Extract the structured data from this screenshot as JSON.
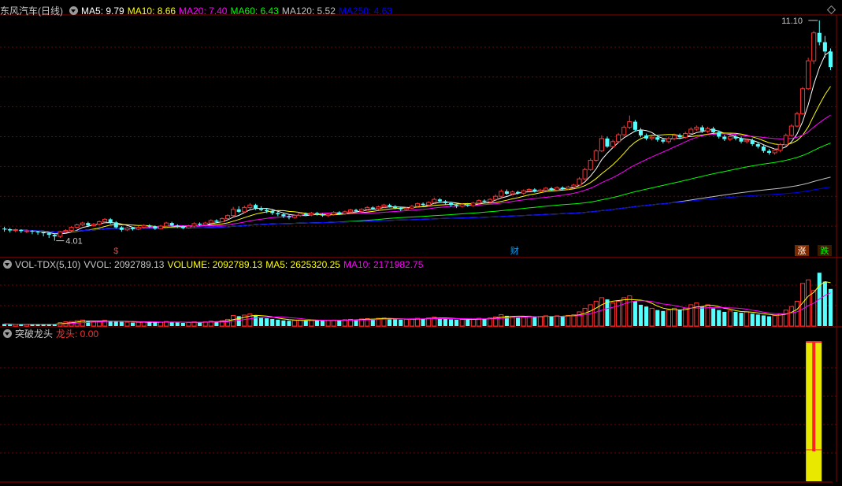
{
  "main_panel": {
    "stock_name": "东风汽车",
    "period": "(日线)",
    "ma_items": [
      {
        "label": "MA5: 9.79",
        "color": "#ffffff"
      },
      {
        "label": "MA10: 8.66",
        "color": "#ffff00"
      },
      {
        "label": "MA20: 7.40",
        "color": "#ff00ff"
      },
      {
        "label": "MA60: 6.43",
        "color": "#00ff00"
      },
      {
        "label": "MA120: 5.52",
        "color": "#c0c0c0"
      },
      {
        "label": "MA250: 4.63",
        "color": "#0000ff"
      }
    ],
    "high_label": "11.10",
    "low_label": "4.01",
    "event_markers": [
      {
        "text": "$",
        "color": "#ff3030"
      },
      {
        "text": "财",
        "color": "#00a0ff"
      },
      {
        "text": "涨",
        "color": "#ffffff"
      },
      {
        "text": "跌",
        "color": "#00ff00"
      }
    ]
  },
  "volume_panel": {
    "title": "VOL-TDX(5,10)",
    "items": [
      {
        "label": "VVOL: 2092789.13",
        "color": "#c8c8c8"
      },
      {
        "label": "VOLUME: 2092789.13",
        "color": "#ffff00"
      },
      {
        "label": "MA5: 2625320.25",
        "color": "#ffff00"
      },
      {
        "label": "MA10: 2171982.75",
        "color": "#ff00ff"
      }
    ]
  },
  "indicator_panel": {
    "title": "突破龙头",
    "items": [
      {
        "label": "龙头: 0.00",
        "color": "#ff3030"
      }
    ]
  },
  "colors": {
    "up": "#ff3333",
    "down": "#54ffff",
    "grid": "#7a0000",
    "signal_outer": "#e8e800",
    "signal_inner": "#ff2020"
  },
  "chart_data": {
    "type": "candlestick",
    "price_range": [
      4.01,
      11.1
    ],
    "ohlc": [
      [
        4.4,
        4.38,
        4.46,
        4.3
      ],
      [
        4.38,
        4.34,
        4.42,
        4.28
      ],
      [
        4.34,
        4.36,
        4.4,
        4.28
      ],
      [
        4.36,
        4.32,
        4.38,
        4.26
      ],
      [
        4.32,
        4.33,
        4.37,
        4.25
      ],
      [
        4.33,
        4.3,
        4.35,
        4.22
      ],
      [
        4.3,
        4.28,
        4.33,
        4.2
      ],
      [
        4.28,
        4.25,
        4.3,
        4.15
      ],
      [
        4.25,
        4.2,
        4.28,
        4.1
      ],
      [
        4.2,
        4.15,
        4.23,
        4.01
      ],
      [
        4.15,
        4.3,
        4.33,
        4.1
      ],
      [
        4.3,
        4.34,
        4.38,
        4.25
      ],
      [
        4.34,
        4.44,
        4.48,
        4.3
      ],
      [
        4.44,
        4.52,
        4.56,
        4.4
      ],
      [
        4.52,
        4.58,
        4.62,
        4.48
      ],
      [
        4.58,
        4.5,
        4.62,
        4.45
      ],
      [
        4.5,
        4.54,
        4.58,
        4.46
      ],
      [
        4.54,
        4.62,
        4.66,
        4.5
      ],
      [
        4.62,
        4.7,
        4.74,
        4.58
      ],
      [
        4.7,
        4.6,
        4.74,
        4.55
      ],
      [
        4.6,
        4.44,
        4.64,
        4.4
      ],
      [
        4.44,
        4.36,
        4.48,
        4.3
      ],
      [
        4.36,
        4.42,
        4.46,
        4.32
      ],
      [
        4.42,
        4.38,
        4.46,
        4.34
      ],
      [
        4.38,
        4.44,
        4.48,
        4.35
      ],
      [
        4.44,
        4.5,
        4.54,
        4.4
      ],
      [
        4.5,
        4.46,
        4.54,
        4.42
      ],
      [
        4.46,
        4.4,
        4.5,
        4.36
      ],
      [
        4.4,
        4.48,
        4.52,
        4.38
      ],
      [
        4.48,
        4.58,
        4.62,
        4.44
      ],
      [
        4.58,
        4.5,
        4.62,
        4.46
      ],
      [
        4.5,
        4.46,
        4.54,
        4.42
      ],
      [
        4.46,
        4.42,
        4.5,
        4.38
      ],
      [
        4.42,
        4.48,
        4.52,
        4.4
      ],
      [
        4.48,
        4.56,
        4.6,
        4.44
      ],
      [
        4.56,
        4.52,
        4.6,
        4.48
      ],
      [
        4.52,
        4.58,
        4.62,
        4.5
      ],
      [
        4.58,
        4.66,
        4.7,
        4.54
      ],
      [
        4.66,
        4.62,
        4.7,
        4.58
      ],
      [
        4.62,
        4.72,
        4.76,
        4.6
      ],
      [
        4.72,
        4.82,
        4.86,
        4.68
      ],
      [
        4.82,
        5.02,
        5.1,
        4.78
      ],
      [
        5.02,
        4.94,
        5.12,
        4.9
      ],
      [
        4.94,
        5.08,
        5.14,
        4.9
      ],
      [
        5.08,
        5.16,
        5.22,
        5.02
      ],
      [
        5.16,
        5.06,
        5.2,
        5.0
      ],
      [
        5.06,
        5.0,
        5.12,
        4.96
      ],
      [
        5.0,
        4.96,
        5.06,
        4.9
      ],
      [
        4.96,
        4.9,
        5.0,
        4.84
      ],
      [
        4.9,
        4.86,
        4.94,
        4.8
      ],
      [
        4.86,
        4.8,
        4.9,
        4.74
      ],
      [
        4.8,
        4.76,
        4.84,
        4.7
      ],
      [
        4.76,
        4.82,
        4.86,
        4.72
      ],
      [
        4.82,
        4.88,
        4.92,
        4.78
      ],
      [
        4.88,
        4.84,
        4.92,
        4.8
      ],
      [
        4.84,
        4.9,
        4.94,
        4.8
      ],
      [
        4.9,
        4.86,
        4.94,
        4.82
      ],
      [
        4.86,
        4.82,
        4.9,
        4.78
      ],
      [
        4.82,
        4.86,
        4.9,
        4.78
      ],
      [
        4.86,
        4.92,
        4.96,
        4.82
      ],
      [
        4.92,
        4.88,
        4.96,
        4.84
      ],
      [
        4.88,
        4.94,
        4.98,
        4.84
      ],
      [
        4.94,
        5.0,
        5.04,
        4.9
      ],
      [
        5.0,
        4.96,
        5.04,
        4.92
      ],
      [
        4.96,
        5.02,
        5.06,
        4.92
      ],
      [
        5.02,
        5.08,
        5.12,
        4.98
      ],
      [
        5.08,
        5.04,
        5.12,
        5.0
      ],
      [
        5.04,
        5.1,
        5.14,
        5.0
      ],
      [
        5.1,
        5.16,
        5.2,
        5.06
      ],
      [
        5.16,
        5.12,
        5.2,
        5.08
      ],
      [
        5.12,
        5.06,
        5.16,
        5.02
      ],
      [
        5.06,
        5.02,
        5.1,
        4.96
      ],
      [
        5.02,
        5.06,
        5.1,
        4.98
      ],
      [
        5.06,
        5.12,
        5.16,
        5.02
      ],
      [
        5.12,
        5.2,
        5.24,
        5.08
      ],
      [
        5.2,
        5.16,
        5.24,
        5.12
      ],
      [
        5.16,
        5.24,
        5.28,
        5.12
      ],
      [
        5.24,
        5.34,
        5.4,
        5.2
      ],
      [
        5.34,
        5.28,
        5.38,
        5.24
      ],
      [
        5.28,
        5.22,
        5.32,
        5.18
      ],
      [
        5.22,
        5.16,
        5.26,
        5.1
      ],
      [
        5.16,
        5.12,
        5.2,
        5.06
      ],
      [
        5.12,
        5.18,
        5.22,
        5.08
      ],
      [
        5.18,
        5.14,
        5.22,
        5.1
      ],
      [
        5.14,
        5.22,
        5.26,
        5.1
      ],
      [
        5.22,
        5.3,
        5.34,
        5.18
      ],
      [
        5.3,
        5.26,
        5.34,
        5.22
      ],
      [
        5.26,
        5.34,
        5.38,
        5.22
      ],
      [
        5.34,
        5.44,
        5.5,
        5.3
      ],
      [
        5.44,
        5.6,
        5.66,
        5.4
      ],
      [
        5.6,
        5.52,
        5.66,
        5.48
      ],
      [
        5.52,
        5.58,
        5.62,
        5.48
      ],
      [
        5.58,
        5.54,
        5.62,
        5.5
      ],
      [
        5.54,
        5.62,
        5.66,
        5.5
      ],
      [
        5.62,
        5.66,
        5.7,
        5.58
      ],
      [
        5.66,
        5.6,
        5.7,
        5.56
      ],
      [
        5.6,
        5.64,
        5.68,
        5.56
      ],
      [
        5.64,
        5.7,
        5.74,
        5.6
      ],
      [
        5.7,
        5.64,
        5.74,
        5.6
      ],
      [
        5.64,
        5.72,
        5.76,
        5.6
      ],
      [
        5.72,
        5.68,
        5.76,
        5.64
      ],
      [
        5.68,
        5.74,
        5.78,
        5.64
      ],
      [
        5.74,
        5.8,
        5.84,
        5.7
      ],
      [
        5.8,
        6.0,
        6.06,
        5.76
      ],
      [
        6.0,
        6.3,
        6.36,
        5.96
      ],
      [
        6.3,
        6.6,
        6.66,
        6.26
      ],
      [
        6.6,
        6.9,
        6.96,
        6.56
      ],
      [
        6.9,
        7.3,
        7.4,
        6.86
      ],
      [
        7.3,
        7.04,
        7.36,
        7.0
      ],
      [
        7.04,
        7.2,
        7.26,
        7.0
      ],
      [
        7.2,
        7.42,
        7.48,
        7.16
      ],
      [
        7.42,
        7.66,
        7.72,
        7.38
      ],
      [
        7.66,
        7.84,
        8.04,
        7.6
      ],
      [
        7.84,
        7.58,
        7.9,
        7.52
      ],
      [
        7.58,
        7.4,
        7.64,
        7.34
      ],
      [
        7.4,
        7.3,
        7.46,
        7.24
      ],
      [
        7.3,
        7.34,
        7.4,
        7.24
      ],
      [
        7.34,
        7.26,
        7.4,
        7.2
      ],
      [
        7.26,
        7.2,
        7.32,
        7.14
      ],
      [
        7.2,
        7.3,
        7.36,
        7.14
      ],
      [
        7.3,
        7.4,
        7.46,
        7.24
      ],
      [
        7.4,
        7.34,
        7.46,
        7.28
      ],
      [
        7.34,
        7.46,
        7.52,
        7.3
      ],
      [
        7.46,
        7.6,
        7.66,
        7.4
      ],
      [
        7.6,
        7.66,
        7.72,
        7.54
      ],
      [
        7.66,
        7.54,
        7.72,
        7.48
      ],
      [
        7.54,
        7.62,
        7.68,
        7.48
      ],
      [
        7.62,
        7.5,
        7.68,
        7.44
      ],
      [
        7.5,
        7.36,
        7.56,
        7.3
      ],
      [
        7.36,
        7.28,
        7.42,
        7.22
      ],
      [
        7.28,
        7.36,
        7.42,
        7.22
      ],
      [
        7.36,
        7.3,
        7.42,
        7.24
      ],
      [
        7.3,
        7.2,
        7.36,
        7.14
      ],
      [
        7.2,
        7.24,
        7.3,
        7.14
      ],
      [
        7.24,
        7.12,
        7.3,
        7.06
      ],
      [
        7.12,
        7.04,
        7.18,
        6.98
      ],
      [
        7.04,
        6.9,
        7.1,
        6.84
      ],
      [
        6.9,
        6.84,
        6.96,
        6.78
      ],
      [
        6.84,
        6.92,
        6.98,
        6.78
      ],
      [
        6.92,
        7.1,
        7.16,
        6.86
      ],
      [
        7.1,
        7.4,
        7.46,
        7.06
      ],
      [
        7.4,
        7.7,
        7.76,
        7.36
      ],
      [
        7.7,
        8.1,
        8.16,
        7.66
      ],
      [
        8.1,
        8.9,
        8.96,
        8.06
      ],
      [
        8.9,
        9.8,
        9.9,
        8.86
      ],
      [
        9.8,
        10.7,
        10.76,
        9.7
      ],
      [
        10.7,
        10.4,
        11.1,
        10.3
      ],
      [
        10.4,
        10.1,
        10.6,
        9.9
      ],
      [
        10.1,
        9.6,
        10.2,
        9.5
      ]
    ],
    "volume": [
      120000.0,
      110000.0,
      100000.0,
      110000.0,
      100000.0,
      90000.0,
      100000.0,
      110000.0,
      120000.0,
      130000.0,
      200000.0,
      240000.0,
      260000.0,
      300000.0,
      340000.0,
      280000.0,
      240000.0,
      260000.0,
      320000.0,
      300000.0,
      260000.0,
      240000.0,
      220000.0,
      200000.0,
      220000.0,
      240000.0,
      220000.0,
      200000.0,
      220000.0,
      260000.0,
      240000.0,
      200000.0,
      180000.0,
      200000.0,
      240000.0,
      220000.0,
      240000.0,
      280000.0,
      260000.0,
      300000.0,
      380000.0,
      600000.0,
      560000.0,
      620000.0,
      680000.0,
      580000.0,
      500000.0,
      440000.0,
      400000.0,
      360000.0,
      320000.0,
      300000.0,
      320000.0,
      340000.0,
      320000.0,
      340000.0,
      320000.0,
      300000.0,
      320000.0,
      340000.0,
      320000.0,
      360000.0,
      380000.0,
      360000.0,
      400000.0,
      420000.0,
      400000.0,
      440000.0,
      460000.0,
      420000.0,
      380000.0,
      360000.0,
      380000.0,
      400000.0,
      440000.0,
      420000.0,
      460000.0,
      500000.0,
      460000.0,
      420000.0,
      380000.0,
      360000.0,
      380000.0,
      360000.0,
      400000.0,
      440000.0,
      420000.0,
      460000.0,
      520000.0,
      640000.0,
      580000.0,
      540000.0,
      500000.0,
      540000.0,
      560000.0,
      520000.0,
      540000.0,
      580000.0,
      540000.0,
      580000.0,
      560000.0,
      600000.0,
      640000.0,
      800000.0,
      1000000.0,
      1200000.0,
      1400000.0,
      1600000.0,
      1500000.0,
      1300000.0,
      1400000.0,
      1600000.0,
      1700000.0,
      1400000.0,
      1200000.0,
      1100000.0,
      1000000.0,
      900000.0,
      850000.0,
      900000.0,
      1000000.0,
      900000.0,
      1000000.0,
      1200000.0,
      1300000.0,
      1100000.0,
      1200000.0,
      1000000.0,
      900000.0,
      800000.0,
      850000.0,
      800000.0,
      750000.0,
      800000.0,
      700000.0,
      650000.0,
      600000.0,
      550000.0,
      600000.0,
      700000.0,
      900000.0,
      1100000.0,
      1400000.0,
      2400000.0,
      2600000.0,
      2000000.0,
      3000000.0,
      2500000.0,
      2090000.0
    ],
    "signal": {
      "bar_index": 145,
      "value": 0.0
    }
  }
}
